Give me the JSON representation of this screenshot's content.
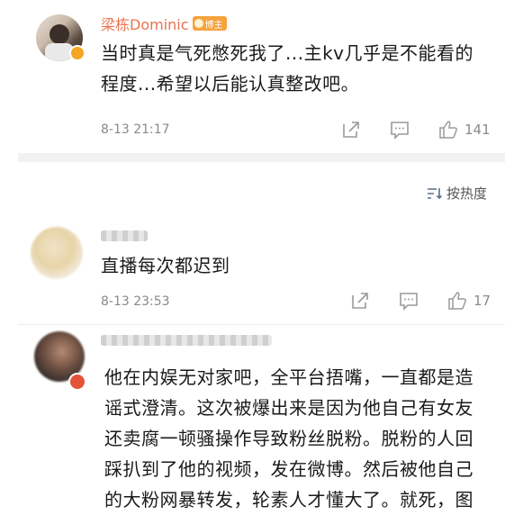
{
  "comments": [
    {
      "username": "梁栋Dominic",
      "badge": "博主",
      "lines": [
        "当时真是气死憋死我了...主kv几乎是不能看的",
        "程度...希望以后能认真整改吧。"
      ],
      "time": "8-13 21:17",
      "likes": "141"
    },
    {
      "lines": [
        "直播每次都迟到"
      ],
      "time": "8-13 23:53",
      "likes": "17"
    },
    {
      "lines": [
        "他在内娱无对家吧，全平台捂嘴，一直都是造",
        "谣式澄清。这次被爆出来是因为他自己有女友",
        "还卖腐一顿骚操作导致粉丝脱粉。脱粉的人回",
        "踩扒到了他的视频，发在微博。然后被他自己",
        "的大粉网暴转发，轮素人才懂大了。就死，图"
      ]
    }
  ],
  "sort_label": "按热度",
  "colors": {
    "username": "#eb7350",
    "badge": "#f7a23b"
  }
}
